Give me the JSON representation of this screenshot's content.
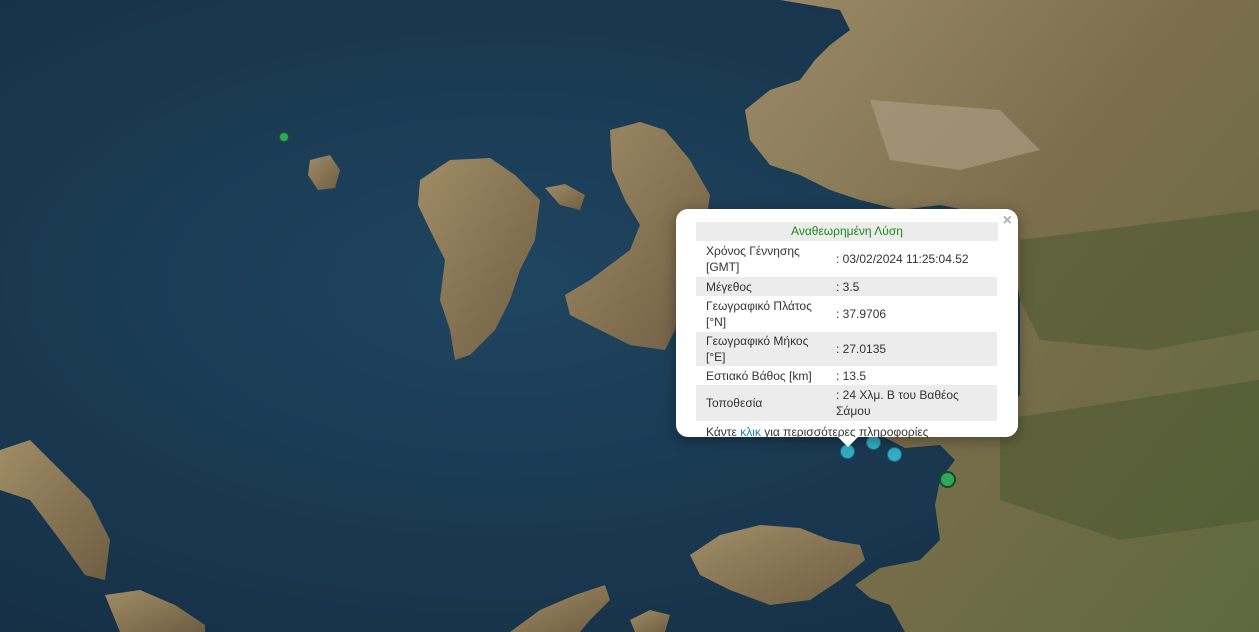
{
  "map": {
    "markers": [
      {
        "name": "epicenter-marker-1",
        "style": "green-small"
      },
      {
        "name": "epicenter-marker-selected",
        "style": "cyan"
      },
      {
        "name": "epicenter-marker-2",
        "style": "cyan"
      },
      {
        "name": "epicenter-marker-3",
        "style": "cyan"
      },
      {
        "name": "epicenter-marker-4",
        "style": "green-big"
      }
    ]
  },
  "popup": {
    "close_symbol": "×",
    "title": "Αναθεωρημένη Λύση",
    "rows": [
      {
        "label": "Χρόνος Γέννησης [GMT]",
        "value": ": 03/02/2024 11:25:04.52"
      },
      {
        "label": "Μέγεθος",
        "value": ": 3.5"
      },
      {
        "label": "Γεωγραφικό Πλάτος [°N]",
        "value": ": 37.9706"
      },
      {
        "label": "Γεωγραφικό Μήκος [°E]",
        "value": ": 27.0135"
      },
      {
        "label": "Εστιακό Βάθος [km]",
        "value": ": 13.5"
      },
      {
        "label": "Τοποθεσία",
        "value": ": 24 Χλμ. Β του Βαθέος Σάμου"
      }
    ],
    "more_prefix": "Κάντε ",
    "more_link": "κλικ",
    "more_suffix": " για περισσότερες πληροφορίες"
  },
  "colors": {
    "sea": "#1b3a52",
    "land": "#8a7a5a",
    "title_green": "#1a8a1a",
    "link_blue": "#1d7fb8",
    "marker_cyan": "#35b6cf",
    "marker_green": "#2ea85a"
  }
}
